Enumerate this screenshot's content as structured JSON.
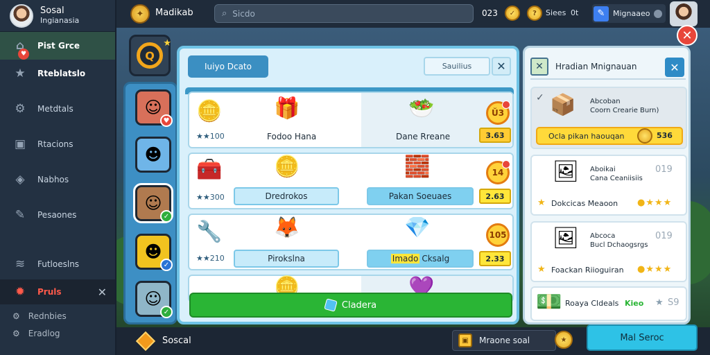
{
  "sidebar": {
    "brand_title": "Sosal",
    "brand_subtitle": "Ingianasia",
    "items": [
      {
        "label": "Pist Grce",
        "icon": "house-icon"
      },
      {
        "label": "Rteblatslo",
        "icon": "star-icon"
      },
      {
        "label": "Metdtals",
        "icon": "gear-icon"
      },
      {
        "label": "Rtacions",
        "icon": "square-icon"
      },
      {
        "label": "Nabhos",
        "icon": "layers-icon"
      },
      {
        "label": "Pesaones",
        "icon": "chat-icon"
      },
      {
        "label": "Futloeslns",
        "icon": "stack-icon"
      }
    ],
    "danger_item": {
      "label": "Pruls"
    },
    "footer_items": [
      {
        "label": "Rednbies"
      },
      {
        "label": "Eradlog"
      }
    ]
  },
  "topbar": {
    "game_name": "Madikab",
    "search_placeholder": "Sicdo",
    "coin_count": "023",
    "stat_label": "Siees",
    "stat_value": "0t",
    "profile_label": "Mignaaeo"
  },
  "left_logo": {
    "glyph": "Q"
  },
  "shop": {
    "tab_label": "Iuiyo Dcato",
    "filter_label": "Sauilius",
    "rows": [
      {
        "left_meta": "★★100",
        "left_name": "Fodoo Hana",
        "right_name": "Dane Rreane",
        "badge": "Ŭ3",
        "price": "3.63"
      },
      {
        "left_meta": "★★300",
        "left_name": "Dredrokos",
        "right_name": "Pakan Soeuaes",
        "badge": "14",
        "price": "2.63"
      },
      {
        "left_meta": "★★210",
        "left_name": "Pirokslna",
        "right_highlight": "Imado",
        "right_name": "Cksalg",
        "badge": "105",
        "price": "2.33"
      }
    ],
    "cta_label": "Cladera"
  },
  "right_panel": {
    "title": "Hradian Mnignauan",
    "cards": [
      {
        "title1": "Abcoban",
        "title2": "Coorn Crearie Burn)",
        "bar_label": "Ocla pikan haouqan",
        "bar_value": "536"
      },
      {
        "title1": "Aboikai",
        "title2": "Cana Ceaniisiis",
        "num": "019",
        "foot": "Dokcicas Meaoon"
      },
      {
        "title1": "Abcoca",
        "title2": "Bucl Dchaogsrgs",
        "num": "019",
        "foot": "Foackan Riioguiran"
      },
      {
        "foot": "Roaya Cldeals",
        "foot_accent": "Kieo",
        "num": "S9"
      }
    ]
  },
  "bottombar": {
    "label": "Soscal",
    "pill_label": "Mraone soal",
    "button_label": "Mal Seroc"
  },
  "colors": {
    "accent": "#2ab535",
    "brand_blue": "#3b8fc2",
    "danger": "#e8463a",
    "gold": "#ffd93a"
  }
}
